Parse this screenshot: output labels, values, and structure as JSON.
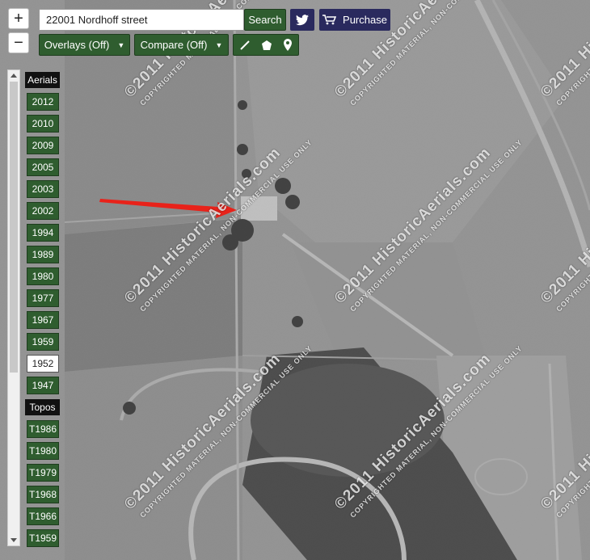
{
  "toolbar": {
    "zoom_in": "+",
    "zoom_out": "−",
    "search_value": "22001 Nordhoff street",
    "search_button": "Search",
    "twitter_icon": "twitter-bird",
    "purchase_label": "Purchase",
    "overlays_label": "Overlays (Off)",
    "compare_label": "Compare (Off)",
    "tools": [
      "line-tool-icon",
      "polygon-tool-icon",
      "marker-tool-icon"
    ]
  },
  "sidebar": {
    "aerials_header": "Aerials",
    "aerials": [
      "2012",
      "2010",
      "2009",
      "2005",
      "2003",
      "2002",
      "1994",
      "1989",
      "1980",
      "1977",
      "1967",
      "1959",
      "1952",
      "1947"
    ],
    "selected_year": "1952",
    "topos_header": "Topos",
    "topos": [
      "T1986",
      "T1980",
      "T1979",
      "T1968",
      "T1966",
      "T1959"
    ]
  },
  "watermark": {
    "line1": "©2011 HistoricAerials.com",
    "line2": "COPYRIGHTED MATERIAL, NON-COMMERCIAL USE ONLY"
  },
  "colors": {
    "button_green": "#2f5d2f",
    "purchase_navy": "#2a2a5e",
    "twitter_navy": "#2a2a5e",
    "annotation_arrow": "#e8221a"
  }
}
